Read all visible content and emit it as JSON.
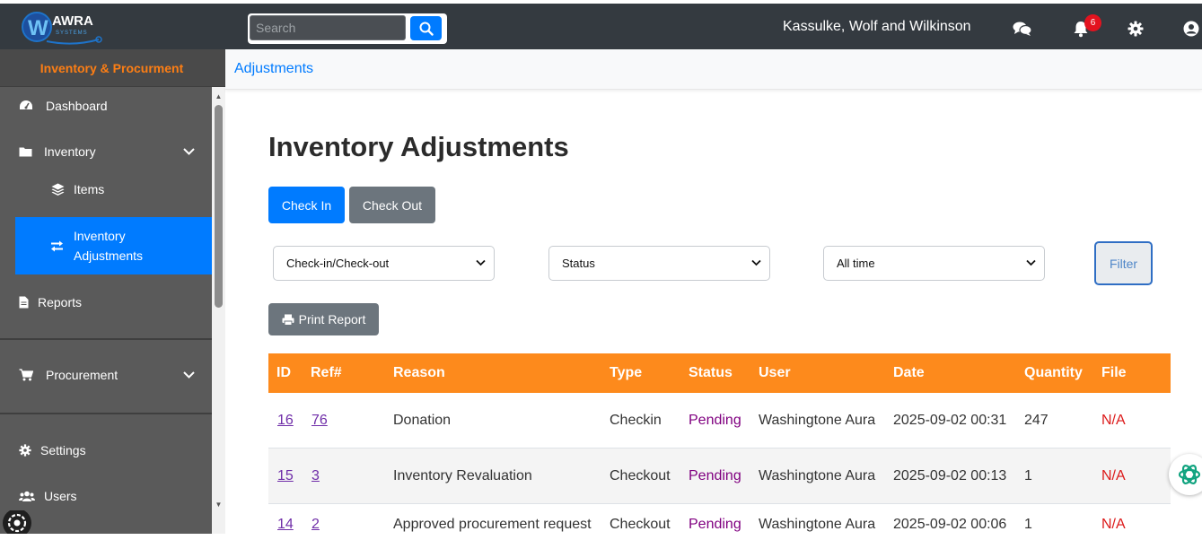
{
  "brand": {
    "logo_text": "AWRA",
    "logo_sub": "SYSTEMS"
  },
  "header": {
    "search_placeholder": "Search",
    "company": "Kassulke, Wolf and Wilkinson",
    "notification_count": "6"
  },
  "sidebar": {
    "title": "Inventory & Procurment",
    "items": [
      {
        "label": "Dashboard"
      },
      {
        "label": "Inventory"
      },
      {
        "label": "Items"
      },
      {
        "label": "Inventory Adjustments"
      },
      {
        "label": "Reports"
      },
      {
        "label": "Procurement"
      },
      {
        "label": "Settings"
      },
      {
        "label": "Users"
      }
    ]
  },
  "breadcrumb": "Adjustments",
  "page": {
    "title": "Inventory Adjustments",
    "check_in": "Check In",
    "check_out": "Check Out",
    "filters": {
      "type": "Check-in/Check-out",
      "status": "Status",
      "period": "All time",
      "filter_label": "Filter"
    },
    "print_report": "Print Report"
  },
  "table": {
    "columns": [
      "ID",
      "Ref#",
      "Reason",
      "Type",
      "Status",
      "User",
      "Date",
      "Quantity",
      "File"
    ],
    "rows": [
      {
        "id": "16",
        "ref": "76",
        "reason": "Donation",
        "type": "Checkin",
        "status": "Pending",
        "user": "Washingtone Aura",
        "date": "2025-09-02 00:31",
        "quantity": "247",
        "file": "N/A"
      },
      {
        "id": "15",
        "ref": "3",
        "reason": "Inventory Revaluation",
        "type": "Checkout",
        "status": "Pending",
        "user": "Washingtone Aura",
        "date": "2025-09-02 00:13",
        "quantity": "1",
        "file": "N/A"
      },
      {
        "id": "14",
        "ref": "2",
        "reason": "Approved procurement request",
        "type": "Checkout",
        "status": "Pending",
        "user": "Washingtone Aura",
        "date": "2025-09-02 00:06",
        "quantity": "1",
        "file": "N/A"
      }
    ]
  },
  "colors": {
    "topbar": "#343a40",
    "sidebar": "#5a5a5a",
    "accent": "#007bff",
    "table_header": "#fd8a1c",
    "sidebar_title": "#fd7e14"
  }
}
